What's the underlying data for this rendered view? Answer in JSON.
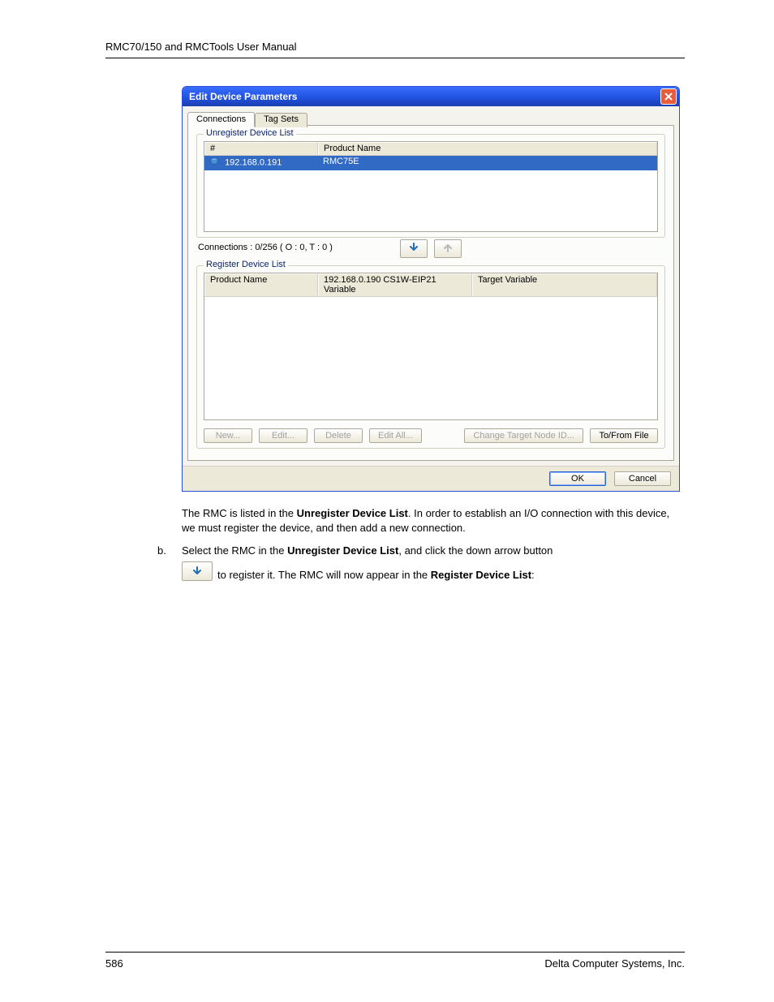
{
  "header": "RMC70/150 and RMCTools User Manual",
  "dialog": {
    "title": "Edit Device Parameters",
    "tabs": {
      "connections": "Connections",
      "tagsets": "Tag Sets"
    },
    "group_unregister": "Unregister Device List",
    "group_register": "Register Device List",
    "col_hash": "#",
    "col_product_name": "Product Name",
    "col_cs1w": "192.168.0.190 CS1W-EIP21 Variable",
    "col_target_var": "Target Variable",
    "unreg_row_ip": "192.168.0.191",
    "unreg_row_product": "RMC75E",
    "connections_status": "Connections :   0/256 ( O : 0, T : 0 )",
    "btn_new": "New...",
    "btn_edit": "Edit...",
    "btn_delete": "Delete",
    "btn_editall": "Edit All...",
    "btn_change_target": "Change Target Node ID...",
    "btn_tofrom": "To/From File",
    "btn_ok": "OK",
    "btn_cancel": "Cancel"
  },
  "para1_a": "The RMC is listed in the ",
  "para1_b": "Unregister Device List",
  "para1_c": ". In order to establish an I/O connection with this device, we must register the device, and then add a new connection.",
  "step_letter": "b.",
  "para2_a": "Select the RMC in the ",
  "para2_b": "Unregister Device List",
  "para2_c": ", and click the down arrow button",
  "para3_a": " to register it. The RMC will now appear in the ",
  "para3_b": "Register Device List",
  "para3_c": ":",
  "footer": {
    "page": "586",
    "company": "Delta Computer Systems, Inc."
  }
}
